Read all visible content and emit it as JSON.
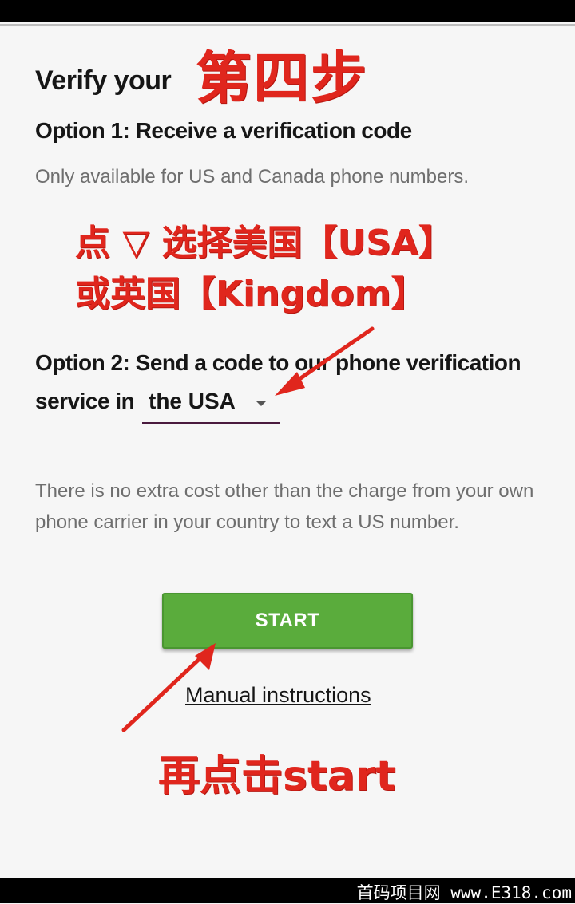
{
  "header": {
    "title": "Verify your"
  },
  "option1": {
    "heading": "Option 1: Receive a verification code",
    "description": "Only available for US and Canada phone numbers."
  },
  "option2": {
    "heading_line1": "Option 2: Send a code to our phone verification",
    "heading_line2_prefix": "service in",
    "country_selected": "the USA",
    "description": "There is no extra cost other than the charge from your own phone carrier in your country to text a US number."
  },
  "actions": {
    "start_label": "START",
    "manual_link": "Manual instructions"
  },
  "annotations": {
    "step_label": "第四步",
    "note_line1": "点 ▽ 选择美国【USA】",
    "note_line2": "或英国【Kingdom】",
    "note_bottom": "再点击start",
    "color": "#e0261d"
  },
  "watermark": {
    "text": "首码项目网 www.E318.com"
  },
  "theme": {
    "button_green": "#5aac3c",
    "select_underline": "#4a1a3e"
  }
}
